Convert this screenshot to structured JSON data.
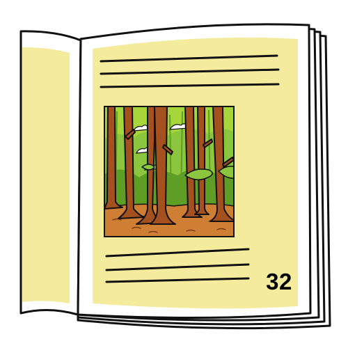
{
  "book": {
    "page_number": "32",
    "text_lines_above_picture": 3,
    "text_lines_below_picture": 3
  },
  "colors": {
    "page": "#f5eb9c",
    "outline": "#111111",
    "paper_white": "#ffffff",
    "bark": "#a4511f",
    "ground": "#cf7f34",
    "canopy_light": "#a7d63a",
    "canopy_dark": "#5f9e24",
    "leaf_bright": "#8cc63f"
  },
  "icons": [
    "open-book-icon",
    "forest-illustration-icon"
  ]
}
